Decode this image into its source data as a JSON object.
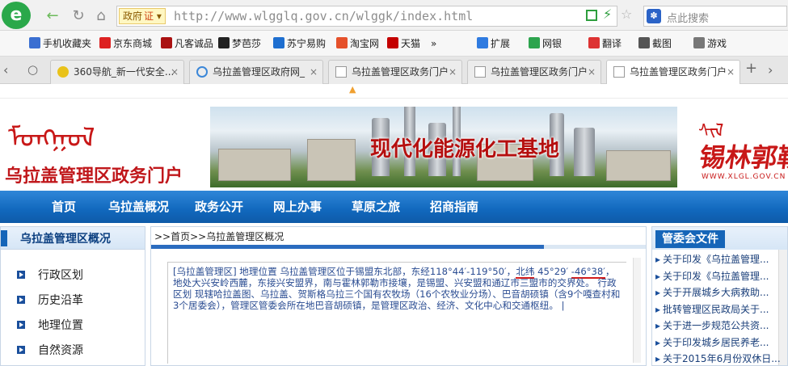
{
  "browser": {
    "logo_glyph": "e",
    "gov_badge": "政府",
    "gov_badge_mark": "证",
    "url_host": "http://www.wlgglq.gov.cn",
    "url_path": "/wlggk/index.html",
    "search_placeholder": "点此搜索",
    "bookmarks": [
      {
        "label": "手机收藏夹",
        "icon": "phone-icon",
        "color": "#3a6fd1"
      },
      {
        "label": "京东商城",
        "icon": "jd-icon",
        "color": "#d22"
      },
      {
        "label": "凡客诚品",
        "icon": "vancl-icon",
        "color": "#a11"
      },
      {
        "label": "梦芭莎",
        "icon": "moonbasa-icon",
        "color": "#222"
      },
      {
        "label": "苏宁易购",
        "icon": "suning-icon",
        "color": "#1e6fd0"
      },
      {
        "label": "淘宝网",
        "icon": "taobao-icon",
        "color": "#e5512b"
      },
      {
        "label": "天猫",
        "icon": "tmall-icon",
        "color": "#c40000"
      },
      {
        "label": "»",
        "icon": "",
        "color": ""
      },
      {
        "label": "扩展",
        "icon": "extension-icon",
        "color": "#2f7be0"
      },
      {
        "label": "网银",
        "icon": "bank-icon",
        "color": "#2da44e"
      },
      {
        "label": "翻译",
        "icon": "translate-icon",
        "color": "#d33"
      },
      {
        "label": "截图",
        "icon": "screenshot-icon",
        "color": "#555"
      },
      {
        "label": "游戏",
        "icon": "game-icon",
        "color": "#777"
      }
    ],
    "tabs": [
      {
        "label": "360导航_新一代安全..."
      },
      {
        "label": "乌拉盖管理区政府网_"
      },
      {
        "label": "乌拉盖管理区政务门户"
      },
      {
        "label": "乌拉盖管理区政务门户"
      },
      {
        "label": "乌拉盖管理区政务门户"
      }
    ],
    "tab_new": "+",
    "tab_close": "×"
  },
  "banner": {
    "site_title": "乌拉盖管理区政务门户",
    "photo_caption": "现代化能源化工基地",
    "calligraphy": "锡林郭勒",
    "calli_url": "WWW.XLGL.GOV.CN"
  },
  "nav": [
    "首页",
    "乌拉盖概况",
    "政务公开",
    "网上办事",
    "草原之旅",
    "招商指南"
  ],
  "left": {
    "title": "乌拉盖管理区概况",
    "items": [
      "行政区划",
      "历史沿革",
      "地理位置",
      "自然资源"
    ]
  },
  "center": {
    "breadcrumb": ">>首页>>乌拉盖管理区概况",
    "text_a": "[乌拉盖管理区] 地理位置 乌拉盖管理区位于锡盟东北部，东经118°44′-119°50′，",
    "text_b": "北纬",
    "text_c": "45°29′",
    "text_d": "-46°38′",
    "text_e": "，地处大兴安岭西麓，东接兴安盟界，南与霍林郭勒市接壤，是锡盟、兴安盟和通辽市三盟市的交界处。 行政区划 现辖哈拉盖图、乌拉盖、贺斯格乌拉三个国有农牧场（16个农牧业分场）、巴音胡硕镇（含9个嘎查村和3个居委会），管理区管委会所在地巴音胡硕镇，是管理区政治、经济、文化中心和交通枢纽。"
  },
  "right": {
    "title": "管委会文件",
    "items": [
      "关于印发《乌拉盖管理...",
      "关于印发《乌拉盖管理...",
      "关于开展城乡大病救助...",
      "批转管理区民政局关于...",
      "关于进一步规范公共资...",
      "关于印发城乡居民养老...",
      "关于2015年6月份双休日..."
    ]
  },
  "colors": {
    "nav_blue": "#1168bd",
    "title_red": "#c0171b",
    "link_blue": "#1a3f7a"
  }
}
